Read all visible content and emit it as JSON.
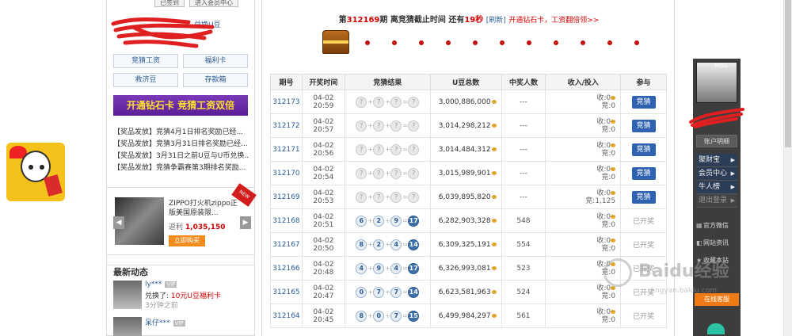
{
  "left": {
    "top_buttons": [
      "已签到",
      "进入会员中心"
    ],
    "exchange_text": "兑换U豆",
    "grid_buttons": [
      "竞猜工资",
      "福利卡",
      "救济豆",
      "存款箱"
    ],
    "promo_banner": "开通钻石卡  竞猜工资双倍",
    "news": [
      "【奖品发放】竞猜4月1日排名奖励已经...",
      "【奖品发放】竞猜3月31日排名奖励已经...",
      "【奖品发放】3月31日之前U豆与U币兑换...",
      "【奖品发放】竞猜争霸赛第3期排名奖励..."
    ],
    "prize": {
      "ribbon": "NEW",
      "name": "ZIPPO打火机zippo正版美国原装限...",
      "price_label": "返利",
      "price": "1,035,150",
      "buy_label": "立即购买",
      "prev": "◀",
      "next": "▶"
    },
    "activity": {
      "heading": "最新动态",
      "items": [
        {
          "user": "ly***",
          "level": "VIP",
          "action_prefix": "兑换了:",
          "item": "10元U豆福利卡",
          "time": "3分钟之前"
        },
        {
          "user": "呆仔***",
          "level": "VIP",
          "action_prefix": "",
          "item": "",
          "time": ""
        }
      ]
    }
  },
  "main": {
    "period_prefix": "第",
    "period_number": "312169",
    "period_suffix": "期  离竞猜截止时间  还有",
    "seconds": "19秒",
    "refresh": "[刷新]",
    "open_card": "开通钻石卡，工资翻倍领>>",
    "table": {
      "headers": [
        "期号",
        "开奖时间",
        "竞猜结果",
        "U豆总数",
        "中奖人数",
        "收入/投入",
        "参与"
      ],
      "rows": [
        {
          "period": "312173",
          "date": "04-02",
          "time": "20:59",
          "balls": [
            "?",
            "?",
            "?",
            "?"
          ],
          "pool": "3,000,886,000",
          "winners": "---",
          "income": "收:0",
          "invest": "竞:0",
          "action": "竞猜",
          "open": false
        },
        {
          "period": "312172",
          "date": "04-02",
          "time": "20:57",
          "balls": [
            "?",
            "?",
            "?",
            "?"
          ],
          "pool": "3,014,298,212",
          "winners": "---",
          "income": "收:0",
          "invest": "竞:0",
          "action": "竞猜",
          "open": false
        },
        {
          "period": "312171",
          "date": "04-02",
          "time": "20:56",
          "balls": [
            "?",
            "?",
            "?",
            "?"
          ],
          "pool": "3,014,484,312",
          "winners": "---",
          "income": "收:0",
          "invest": "竞:0",
          "action": "竞猜",
          "open": false
        },
        {
          "period": "312170",
          "date": "04-02",
          "time": "20:54",
          "balls": [
            "?",
            "?",
            "?",
            "?"
          ],
          "pool": "3,015,989,901",
          "winners": "---",
          "income": "收:0",
          "invest": "竞:0",
          "action": "竞猜",
          "open": false
        },
        {
          "period": "312169",
          "date": "04-02",
          "time": "20:53",
          "balls": [
            "?",
            "?",
            "?",
            "?"
          ],
          "pool": "6,039,895,820",
          "winners": "---",
          "income": "收:0",
          "invest": "竞:1,125",
          "action": "竞猜",
          "open": false
        },
        {
          "period": "312168",
          "date": "04-02",
          "time": "20:51",
          "balls": [
            "6",
            "2",
            "9",
            "17"
          ],
          "pool": "6,282,903,328",
          "winners": "548",
          "income": "收:0",
          "invest": "竞:0",
          "action": "已开奖",
          "open": true
        },
        {
          "period": "312167",
          "date": "04-02",
          "time": "20:50",
          "balls": [
            "8",
            "2",
            "4",
            "14"
          ],
          "pool": "6,309,325,191",
          "winners": "554",
          "income": "收:0",
          "invest": "竞:0",
          "action": "已开奖",
          "open": true
        },
        {
          "period": "312166",
          "date": "04-02",
          "time": "20:48",
          "balls": [
            "4",
            "9",
            "4",
            "17"
          ],
          "pool": "6,326,993,081",
          "winners": "523",
          "income": "收:0",
          "invest": "竞:0",
          "action": "已开奖",
          "open": true
        },
        {
          "period": "312165",
          "date": "04-02",
          "time": "20:47",
          "balls": [
            "0",
            "7",
            "7",
            "14"
          ],
          "pool": "6,623,581,963",
          "winners": "524",
          "income": "收:0",
          "invest": "竞:0",
          "action": "已开奖",
          "open": true
        },
        {
          "period": "312164",
          "date": "04-02",
          "time": "20:45",
          "balls": [
            "8",
            "0",
            "7",
            "15"
          ],
          "pool": "6,499,984,297",
          "winners": "561",
          "income": "收:0",
          "invest": "竞:0",
          "action": "已开奖",
          "open": true
        }
      ]
    }
  },
  "right": {
    "nickname": "MiSs",
    "account_detail": "账户明细",
    "menu": [
      "聚财宝",
      "会员中心",
      "牛人榜",
      "退出登录"
    ],
    "links": [
      "官方微信",
      "网站资讯",
      "收藏本站"
    ],
    "service": "在线客服"
  },
  "watermark": {
    "brand": "Baidu经验",
    "url": "jingyan.baidu.com"
  }
}
